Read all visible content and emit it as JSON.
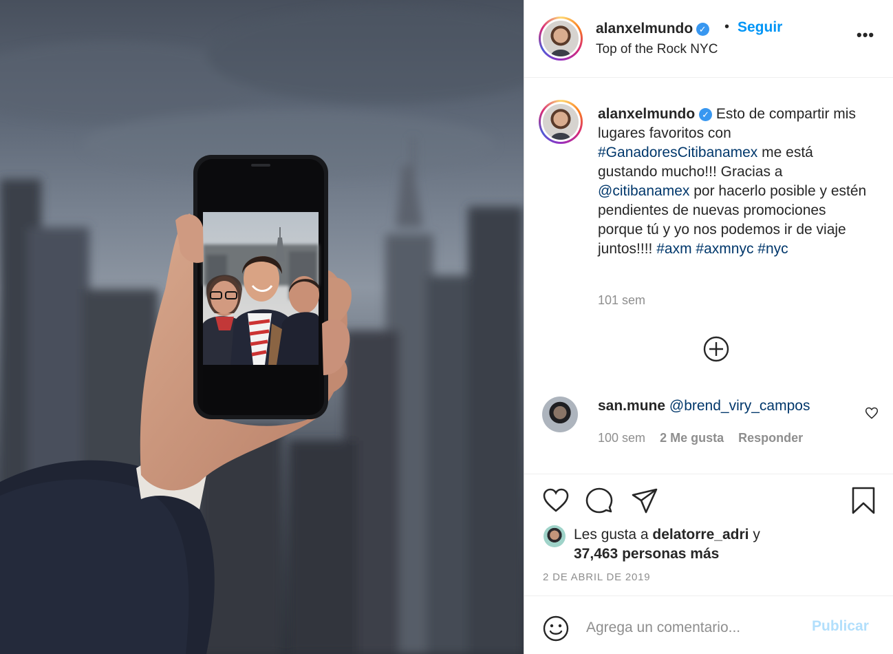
{
  "post": {
    "author": "alanxelmundo",
    "verified_glyph": "✓",
    "separator": "•",
    "follow_label": "Seguir",
    "location": "Top of the Rock NYC",
    "more_glyph": "•••"
  },
  "caption": {
    "author": "alanxelmundo",
    "text_1": " Esto de compartir mis lugares favoritos con ",
    "tag_1": "#GanadoresCitibanamex",
    "text_2": " me está gustando mucho!!! Gracias a ",
    "mention": "@citibanamex",
    "text_3": " por hacerlo posible y estén pendientes de nuevas promociones porque tú y yo nos podemos ir de viaje juntos!!!! ",
    "tag_2": "#axm",
    "tag_3": "#axmnyc",
    "tag_4": "#nyc",
    "time": "101 sem"
  },
  "load_more": {
    "icon": "plus-circle-icon"
  },
  "comment": {
    "author": "san.mune",
    "mention": "@brend_viry_campos",
    "time": "100 sem",
    "likes": "2 Me gusta",
    "reply_label": "Responder"
  },
  "likes": {
    "prefix": "Les gusta a ",
    "user": "delatorre_adri",
    "joiner": " y",
    "others": "37,463 personas más"
  },
  "date": "2 DE ABRIL DE 2019",
  "comment_box": {
    "placeholder": "Agrega un comentario...",
    "publish_label": "Publicar"
  },
  "colors": {
    "link": "#00376b",
    "follow": "#0095f6",
    "publish_disabled": "#b2dffc",
    "muted": "#8e8e8e"
  }
}
